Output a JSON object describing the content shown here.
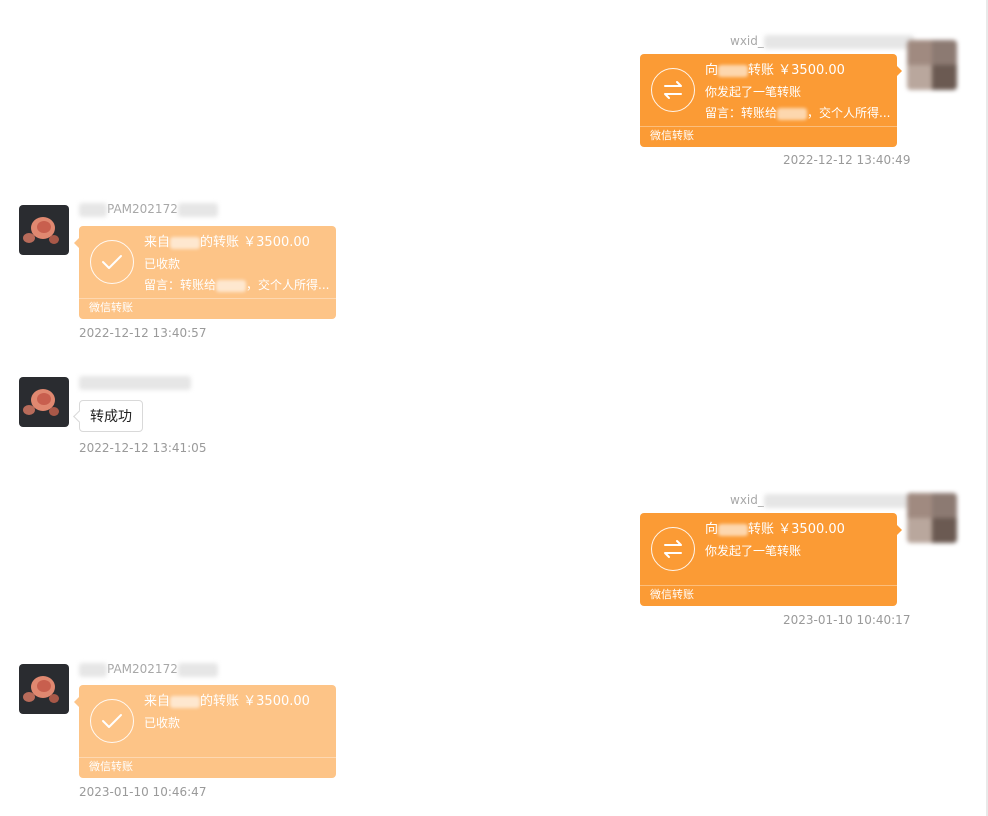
{
  "messages": [
    {
      "direction": "sent",
      "sender": "wxid_",
      "card": {
        "line1_prefix": "向",
        "line1_suffix": "转账 ￥3500.00",
        "line2": "你发起了一笔转账",
        "line3_prefix": "留言：转账给",
        "line3_suffix": "，交个人所得...",
        "footer": "微信转账"
      },
      "time": "2022-12-12 13:40:49"
    },
    {
      "direction": "recv",
      "sender": "PAM202172",
      "card": {
        "line1_prefix": "来自",
        "line1_suffix": "的转账 ￥3500.00",
        "line2": "已收款",
        "line3_prefix": "留言：转账给",
        "line3_suffix": "，交个人所得...",
        "footer": "微信转账"
      },
      "time": "2022-12-12 13:40:57"
    },
    {
      "direction": "recv",
      "sender": "",
      "text": "转成功",
      "time": "2022-12-12 13:41:05"
    },
    {
      "direction": "sent",
      "sender": "wxid_",
      "card": {
        "line1_prefix": "向",
        "line1_suffix": "转账 ￥3500.00",
        "line2": "你发起了一笔转账",
        "footer": "微信转账"
      },
      "time": "2023-01-10 10:40:17"
    },
    {
      "direction": "recv",
      "sender": "PAM202172",
      "card": {
        "line1_prefix": "来自",
        "line1_suffix": "的转账 ￥3500.00",
        "line2": "已收款",
        "footer": "微信转账"
      },
      "time": "2023-01-10 10:46:47"
    }
  ],
  "colors": {
    "sent_card": "#fb9b35",
    "received_card": "#fdc487",
    "timestamp": "#9a9a9a"
  },
  "icons": {
    "sent": "transfer-arrows-icon",
    "received": "checkmark-icon"
  }
}
